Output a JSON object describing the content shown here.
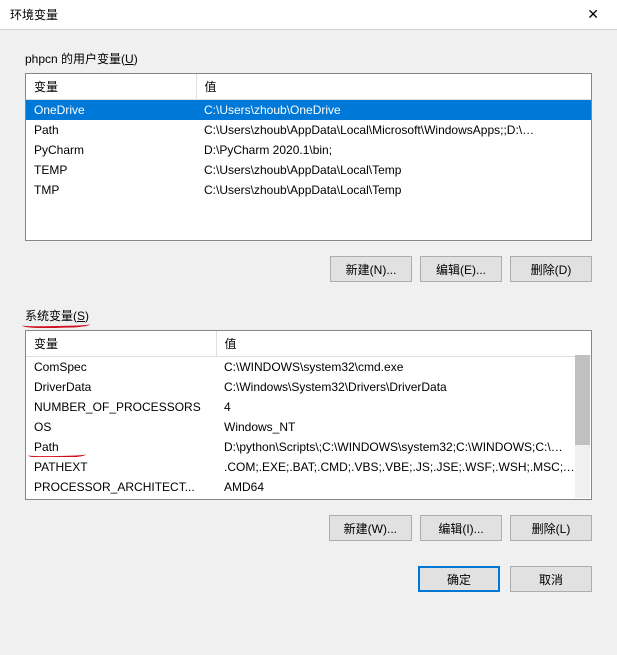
{
  "title": "环境变量",
  "header_variable": "变量",
  "header_value": "值",
  "user": {
    "label_prefix": "phpcn 的用户变量(",
    "label_key": "U",
    "label_suffix": ")",
    "rows": [
      {
        "name": "OneDrive",
        "value": "C:\\Users\\zhoub\\OneDrive",
        "selected": true
      },
      {
        "name": "Path",
        "value": "C:\\Users\\zhoub\\AppData\\Local\\Microsoft\\WindowsApps;;D:\\…"
      },
      {
        "name": "PyCharm",
        "value": "D:\\PyCharm 2020.1\\bin;"
      },
      {
        "name": "TEMP",
        "value": "C:\\Users\\zhoub\\AppData\\Local\\Temp"
      },
      {
        "name": "TMP",
        "value": "C:\\Users\\zhoub\\AppData\\Local\\Temp"
      }
    ],
    "btn_new": "新建(N)...",
    "btn_edit": "编辑(E)...",
    "btn_delete": "删除(D)"
  },
  "system": {
    "label_prefix": "系统变量(",
    "label_key": "S",
    "label_suffix": ")",
    "rows": [
      {
        "name": "ComSpec",
        "value": "C:\\WINDOWS\\system32\\cmd.exe"
      },
      {
        "name": "DriverData",
        "value": "C:\\Windows\\System32\\Drivers\\DriverData"
      },
      {
        "name": "NUMBER_OF_PROCESSORS",
        "value": "4"
      },
      {
        "name": "OS",
        "value": "Windows_NT"
      },
      {
        "name": "Path",
        "value": "D:\\python\\Scripts\\;C:\\WINDOWS\\system32;C:\\WINDOWS;C:\\…",
        "annotated": true
      },
      {
        "name": "PATHEXT",
        "value": ".COM;.EXE;.BAT;.CMD;.VBS;.VBE;.JS;.JSE;.WSF;.WSH;.MSC;.PY;.P…"
      },
      {
        "name": "PROCESSOR_ARCHITECT...",
        "value": "AMD64"
      }
    ],
    "btn_new": "新建(W)...",
    "btn_edit": "编辑(I)...",
    "btn_delete": "删除(L)"
  },
  "btn_ok": "确定",
  "btn_cancel": "取消"
}
